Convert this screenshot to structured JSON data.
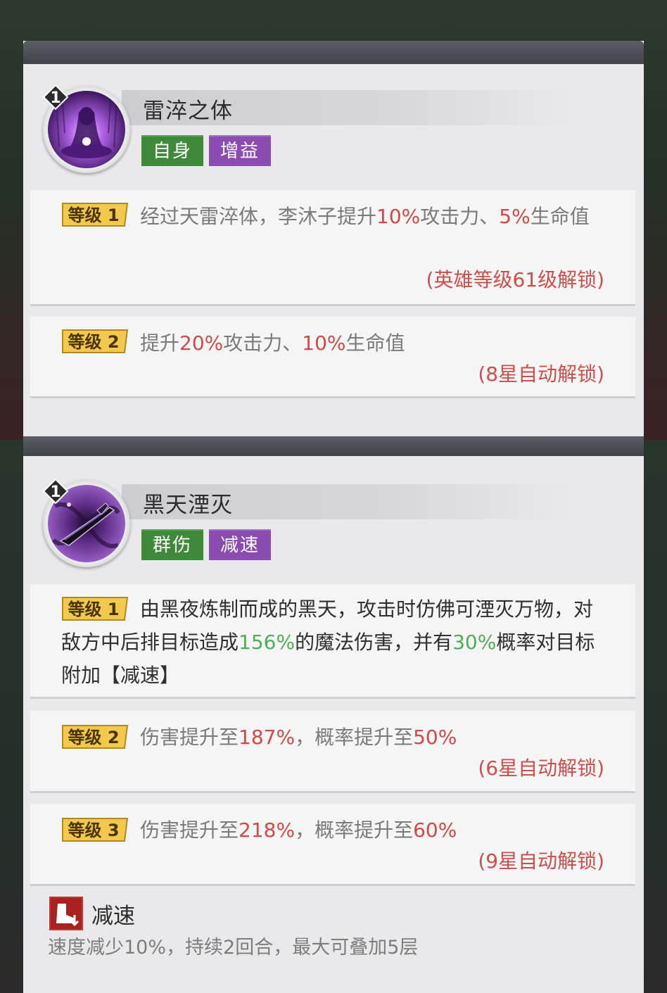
{
  "skills": [
    {
      "level_badge": "1",
      "name": "雷淬之体",
      "tags": [
        "自身",
        "增益"
      ],
      "levels": [
        {
          "badge": "等级 1",
          "text_parts": [
            "经过天雷淬体，李沐子提升",
            "10%",
            "攻击力、",
            "5%",
            "生命值"
          ],
          "unlock": "(英雄等级61级解锁)"
        },
        {
          "badge": "等级 2",
          "text_parts": [
            "提升",
            "20%",
            "攻击力、",
            "10%",
            "生命值"
          ],
          "unlock": "(8星自动解锁)"
        }
      ]
    },
    {
      "level_badge": "1",
      "name": "黑天湮灭",
      "tags": [
        "群伤",
        "减速"
      ],
      "levels": [
        {
          "badge": "等级 1",
          "text_parts": [
            "由黑夜炼制而成的黑天，攻击时仿佛可湮灭万物，对敌方中后排目标造成",
            "156%",
            "的魔法伤害，并有",
            "30%",
            "概率对目标附加【减速】"
          ]
        },
        {
          "badge": "等级 2",
          "text_parts": [
            "伤害提升至",
            "187%",
            "，概率提升至",
            "50%"
          ],
          "unlock": "(6星自动解锁)"
        },
        {
          "badge": "等级 3",
          "text_parts": [
            "伤害提升至",
            "218%",
            "，概率提升至",
            "60%"
          ],
          "unlock": "(9星自动解锁)"
        }
      ]
    }
  ],
  "debuff": {
    "icon": "slow-boot-icon",
    "title": "减速",
    "description": "速度减少10%，持续2回合，最大可叠加5层"
  },
  "colors": {
    "tag_green": "#3f8a3a",
    "tag_purple": "#8a4cb0",
    "highlight_red": "#d04a45",
    "highlight_green": "#4fae55",
    "badge_gold": "#f2c94c"
  }
}
